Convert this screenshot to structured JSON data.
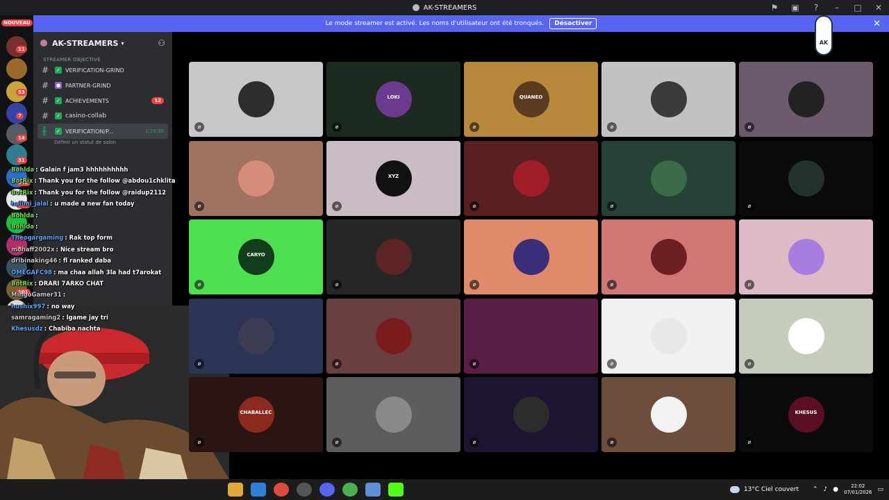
{
  "window": {
    "title": "AK-STREAMERS"
  },
  "banner": {
    "text": "Le mode streamer est activé. Les noms d'utilisateur ont été tronqués.",
    "button": "Désactiver"
  },
  "rail": {
    "nouveau_label": "NOUVEAU",
    "badges": [
      "11",
      "53",
      "7",
      "14",
      "31",
      "342",
      "154",
      "6",
      "101",
      "4",
      "46",
      "134"
    ]
  },
  "sidebar": {
    "server_name": "AK-STREAMERS",
    "category": "STREAMER OBJECTIVE",
    "channels": [
      {
        "name": "VERIFICATION-GRIND",
        "mention": ""
      },
      {
        "name": "PARTNER-GRIND",
        "mention": ""
      },
      {
        "name": "ACHIEVEMENTS",
        "mention": "12"
      },
      {
        "name": "casino-collab",
        "mention": ""
      },
      {
        "name": "VERIFICATION/P...",
        "mention": "",
        "time": "1:29:30"
      }
    ],
    "status_hint": "Définir un statut de salon"
  },
  "chat": [
    {
      "user": "Bohlda",
      "text": ": Galain f jam3 hhhhhhhhhh",
      "color": "#7ed957"
    },
    {
      "user": "BotRix",
      "text": ": Thank you for the follow @abdou1chklita",
      "color": "#7ed957"
    },
    {
      "user": "BotRix",
      "text": ": Thank you for the follow @raidup2112",
      "color": "#7ed957"
    },
    {
      "user": "halimi_jalal",
      "text": ": u made a new fan today",
      "color": "#5da5ff"
    },
    {
      "user": "Bohlda",
      "text": ":",
      "color": "#7ed957"
    },
    {
      "user": "Bohlda",
      "text": ":",
      "color": "#7ed957"
    },
    {
      "user": "Theogargaming",
      "text": ": Rak top form",
      "color": "#5da5ff"
    },
    {
      "user": "mohaff2002x",
      "text": ": Nice stream bro",
      "color": "#c9c9c9"
    },
    {
      "user": "dribinaking46",
      "text": ": fl ranked daba",
      "color": "#c9c9c9"
    },
    {
      "user": "OMEGAFC98",
      "text": ": ma chaa allah 3la had t7arokat",
      "color": "#5da5ff"
    },
    {
      "user": "BotRix",
      "text": ": DRARI 7ARKO CHAT",
      "color": "#7ed957"
    },
    {
      "user": "MingoGamer31",
      "text": ":",
      "color": "#c9c9c9"
    },
    {
      "user": "hushix997",
      "text": ": no way",
      "color": "#5da5ff"
    },
    {
      "user": "samragaming2",
      "text": ": lgame jay tri",
      "color": "#c9c9c9"
    },
    {
      "user": "Khesusdz",
      "text": ": Chabiba nachta",
      "color": "#5da5ff"
    }
  ],
  "tiles": [
    {
      "bg": "#c7c7c9",
      "avatar": "#2d2d2d",
      "label": ""
    },
    {
      "bg": "#1d2a1f",
      "avatar": "#6b3a8f",
      "label": "LOKI"
    },
    {
      "bg": "#b8893c",
      "avatar": "#5c3b1e",
      "label": "QUANEO"
    },
    {
      "bg": "#c2c2c4",
      "avatar": "#3b3b3b",
      "label": ""
    },
    {
      "bg": "#6c5a6c",
      "avatar": "#222",
      "label": ""
    },
    {
      "bg": "#a07262",
      "avatar": "#d78b7b",
      "label": ""
    },
    {
      "bg": "#c9bcc4",
      "avatar": "#111",
      "label": "XYZ"
    },
    {
      "bg": "#5a1f21",
      "avatar": "#a11d2a",
      "label": ""
    },
    {
      "bg": "#264236",
      "avatar": "#3a6b48",
      "label": ""
    },
    {
      "bg": "#0b0b0d",
      "avatar": "#22332f",
      "label": ""
    },
    {
      "bg": "#4ee051",
      "avatar": "#123d1a",
      "label": "CARYO"
    },
    {
      "bg": "#262626",
      "avatar": "#5c2424",
      "label": ""
    },
    {
      "bg": "#e1896b",
      "avatar": "#3b2f7a",
      "label": ""
    },
    {
      "bg": "#d07776",
      "avatar": "#6d1f22",
      "label": ""
    },
    {
      "bg": "#deb9c6",
      "avatar": "#a77ee0",
      "label": ""
    },
    {
      "bg": "#2b3455",
      "avatar": "#3c3c52",
      "label": ""
    },
    {
      "bg": "#6a3f40",
      "avatar": "#7a1c1c",
      "label": ""
    },
    {
      "bg": "#5a1e46",
      "avatar": "#5a1e46",
      "label": ""
    },
    {
      "bg": "#f1f1f1",
      "avatar": "#e8e8e8",
      "label": ""
    },
    {
      "bg": "#c6ccbc",
      "avatar": "#ffffff",
      "label": ""
    },
    {
      "bg": "#2a1512",
      "avatar": "#8c2a1d",
      "label": "CHABALLEC"
    },
    {
      "bg": "#5d5d5f",
      "avatar": "#8a8a8a",
      "label": ""
    },
    {
      "bg": "#1d1431",
      "avatar": "#2c2c2c",
      "label": ""
    },
    {
      "bg": "#6d4e3d",
      "avatar": "#f2f2f2",
      "label": ""
    },
    {
      "bg": "#0b0b0d",
      "avatar": "#5a0f22",
      "label": "KHESUS"
    }
  ],
  "logo": {
    "text": "AK"
  },
  "taskbar": {
    "weather": "13°C  Ciel couvert",
    "time": "22:02",
    "date": "07/01/2026"
  }
}
